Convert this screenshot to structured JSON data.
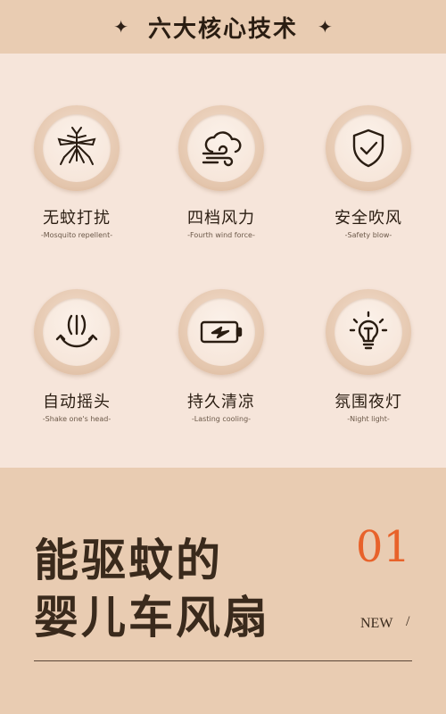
{
  "header": {
    "title": "六大核心技术",
    "left_ornament": "✦",
    "right_ornament": "✦"
  },
  "features": [
    {
      "label": "无蚊打扰",
      "sub": "-Mosquito repellent-",
      "icon": "mosquito-icon"
    },
    {
      "label": "四档风力",
      "sub": "-Fourth wind force-",
      "icon": "wind-cloud-icon"
    },
    {
      "label": "安全吹风",
      "sub": "-Safety blow-",
      "icon": "shield-check-icon"
    },
    {
      "label": "自动摇头",
      "sub": "-Shake one's head-",
      "icon": "oscillate-icon"
    },
    {
      "label": "持久清凉",
      "sub": "-Lasting cooling-",
      "icon": "battery-icon"
    },
    {
      "label": "氛围夜灯",
      "sub": "-Night light-",
      "icon": "light-bulb-icon"
    }
  ],
  "promo": {
    "line1": "能驱蚊的",
    "line2": "婴儿车风扇",
    "number": "01",
    "new_label": "NEW",
    "slash": "/"
  },
  "colors": {
    "accent": "#e8622a",
    "header_bg": "#e9ccb2",
    "panel_bg": "#f6e5da",
    "text_dark": "#2a1d12"
  }
}
